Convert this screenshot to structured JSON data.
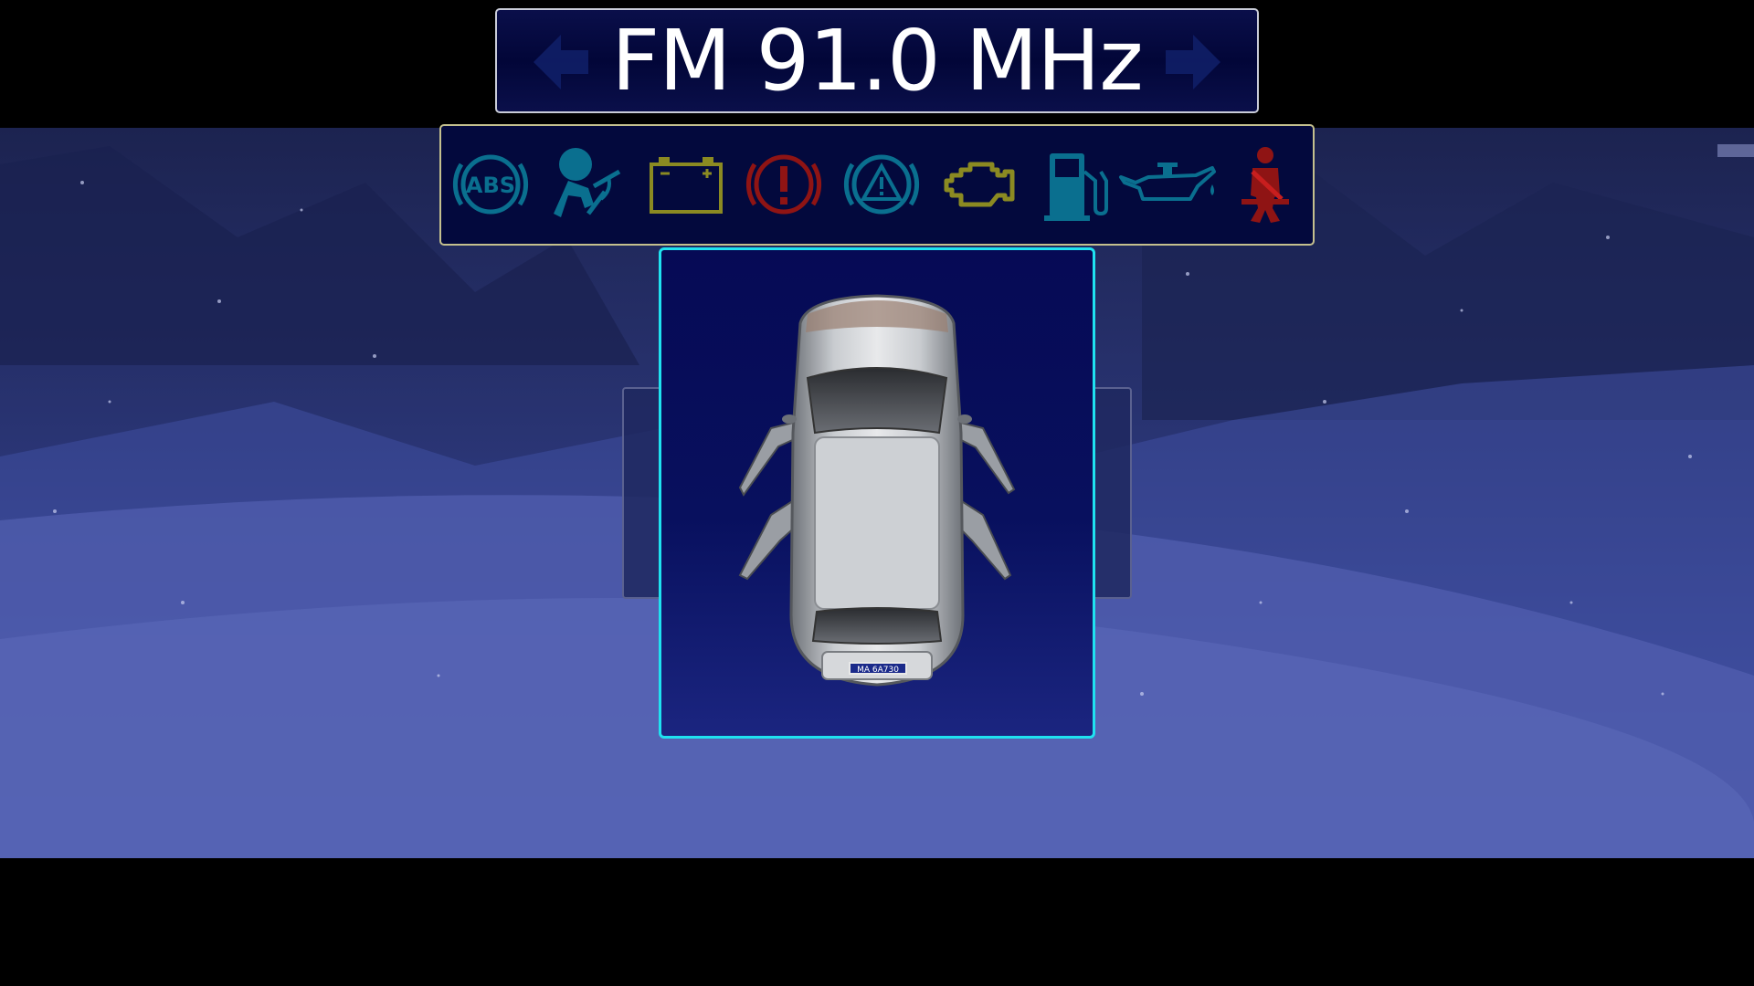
{
  "radio": {
    "band_frequency": "FM 91.0 MHz",
    "prev_icon": "left-arrow-icon",
    "next_icon": "right-arrow-icon"
  },
  "warning_lights": [
    {
      "name": "abs-warning-icon",
      "color": "#0a6f8f"
    },
    {
      "name": "airbag-warning-icon",
      "color": "#0a6f8f"
    },
    {
      "name": "battery-warning-icon",
      "color": "#8b8a22"
    },
    {
      "name": "brake-warning-icon",
      "color": "#8f1414"
    },
    {
      "name": "hazard-warning-icon",
      "color": "#0a6f8f"
    },
    {
      "name": "engine-check-icon",
      "color": "#8b8a22"
    },
    {
      "name": "fuel-level-icon",
      "color": "#0a6f8f"
    },
    {
      "name": "oil-pressure-icon",
      "color": "#0a6f8f"
    },
    {
      "name": "seatbelt-warning-icon",
      "color": "#8f1414"
    }
  ],
  "car": {
    "view": "top-view",
    "doors_open": [
      "front-left",
      "front-right",
      "rear-left",
      "rear-right"
    ],
    "plate_text": "MA 6A730"
  },
  "colors": {
    "panel_border": "#1fe2f0",
    "radio_border": "#c9ccd8",
    "warning_border": "#c4c08e"
  }
}
